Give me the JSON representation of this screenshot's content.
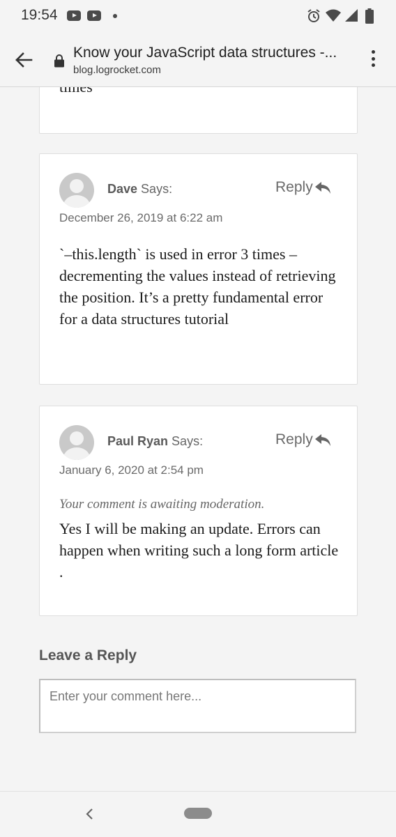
{
  "status_bar": {
    "time": "19:54",
    "icons": [
      "youtube-icon",
      "youtube-icon",
      "dot-icon",
      "alarm-icon",
      "wifi-icon",
      "signal-icon",
      "battery-icon"
    ]
  },
  "app_bar": {
    "title": "Know your JavaScript data structures -...",
    "url": "blog.logrocket.com",
    "icons": [
      "back-arrow-icon",
      "lock-icon",
      "overflow-menu-icon"
    ]
  },
  "partial_comment": {
    "text": "times"
  },
  "comments": [
    {
      "author": "Dave",
      "says": "Says:",
      "reply_label": "Reply",
      "date": "December 26, 2019 at 6:22 am",
      "body": "`–this.length` is used in error 3 times – decrementing the values instead of retrieving the position. It’s a pretty fundamental error for a data structures tutorial"
    },
    {
      "author": "Paul Ryan",
      "says": "Says:",
      "reply_label": "Reply",
      "date": "January 6, 2020 at 2:54 pm",
      "moderation_note": "Your comment is awaiting moderation.",
      "body": "Yes I will be making an update. Errors can happen when writing such a long form article ."
    }
  ],
  "reply_form": {
    "heading": "Leave a Reply",
    "placeholder": "Enter your comment here..."
  },
  "nav_bar": {
    "icons": [
      "nav-back-icon",
      "nav-home-pill"
    ]
  },
  "colors": {
    "background": "#f4f4f4",
    "card": "#ffffff",
    "card_border": "#dedede",
    "text_body": "#1a1a1a",
    "text_muted": "#6a6a6a"
  }
}
